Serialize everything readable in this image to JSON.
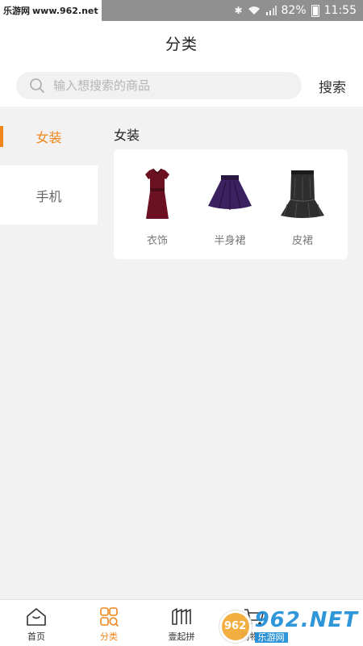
{
  "status_bar": {
    "watermark_brand": "乐游网",
    "watermark_url": "www.962.net",
    "battery": "82%",
    "time": "11:55"
  },
  "header": {
    "title": "分类"
  },
  "search": {
    "placeholder": "输入想搜索的商品",
    "value": "",
    "button_label": "搜索"
  },
  "sidebar": {
    "items": [
      {
        "label": "女装",
        "active": true
      },
      {
        "label": "手机",
        "active": false
      }
    ]
  },
  "content": {
    "section_title": "女装",
    "categories": [
      {
        "label": "衣饰",
        "icon": "red-dress-image"
      },
      {
        "label": "半身裙",
        "icon": "purple-skirt-image"
      },
      {
        "label": "皮裙",
        "icon": "leather-skirt-image"
      }
    ]
  },
  "bottom_nav": {
    "items": [
      {
        "label": "首页",
        "icon": "home-icon",
        "active": false
      },
      {
        "label": "分类",
        "icon": "category-grid-icon",
        "active": true
      },
      {
        "label": "壹起拼",
        "icon": "group-buy-icon",
        "active": false
      },
      {
        "label": "购物车",
        "icon": "cart-icon",
        "active": false
      }
    ]
  },
  "watermark": {
    "logo_text": "962",
    "line1": "962.NET",
    "line2": "乐游网"
  },
  "colors": {
    "accent": "#f08519",
    "background": "#f2f2f2",
    "status_bar": "#909090"
  }
}
